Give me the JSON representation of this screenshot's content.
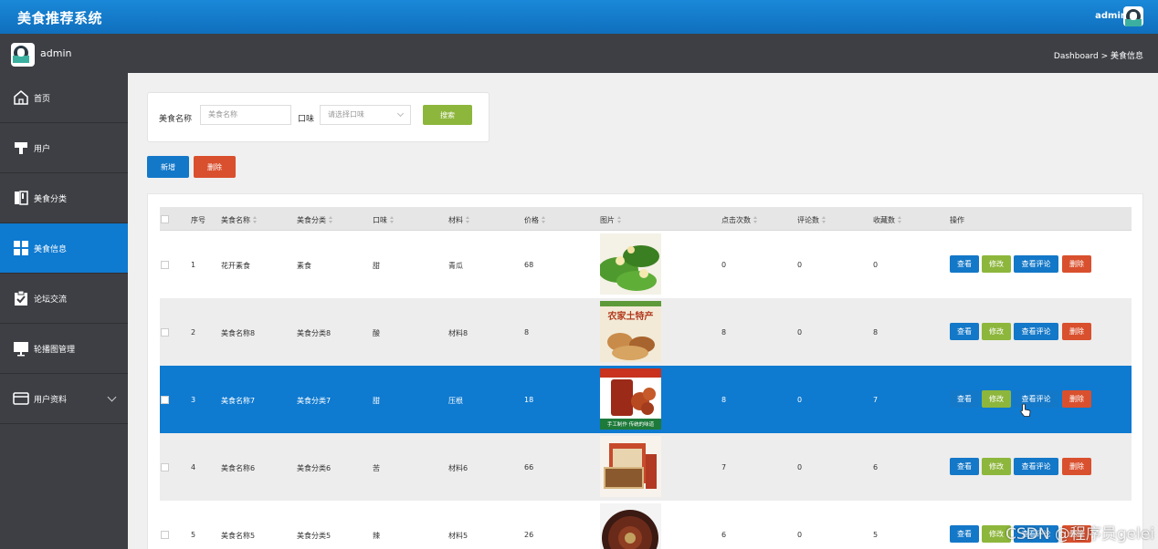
{
  "header": {
    "title": "美食推荐系统",
    "user": "admin"
  },
  "subbar": {
    "user": "admin",
    "breadcrumb": "Dashboard > 美食信息"
  },
  "sidebar": {
    "items": [
      {
        "label": "首页",
        "icon": "home-icon"
      },
      {
        "label": "用户",
        "icon": "user-icon"
      },
      {
        "label": "美食分类",
        "icon": "book-icon"
      },
      {
        "label": "美食信息",
        "icon": "grid-icon",
        "active": true
      },
      {
        "label": "论坛交流",
        "icon": "clipboard-check-icon"
      },
      {
        "label": "轮播图管理",
        "icon": "monitor-icon"
      },
      {
        "label": "用户资料",
        "icon": "card-icon"
      }
    ]
  },
  "search": {
    "name_label": "美食名称",
    "name_placeholder": "美食名称",
    "taste_label": "口味",
    "taste_placeholder": "请选择口味",
    "search_button": "搜索"
  },
  "actions": {
    "add": "新增",
    "delete": "删除"
  },
  "table": {
    "columns": [
      "序号",
      "美食名称",
      "美食分类",
      "口味",
      "材料",
      "价格",
      "图片",
      "点击次数",
      "评论数",
      "收藏数",
      "操作"
    ],
    "row_buttons": {
      "view": "查看",
      "edit": "修改",
      "comments": "查看评论",
      "delete": "删除"
    },
    "rows": [
      {
        "index": "1",
        "name": "花开素食",
        "category": "素食",
        "taste": "甜",
        "material": "青瓜",
        "price": "68",
        "clicks": "0",
        "comments": "0",
        "favorites": "0"
      },
      {
        "index": "2",
        "name": "美食名称8",
        "category": "美食分类8",
        "taste": "酸",
        "material": "材料8",
        "price": "8",
        "clicks": "8",
        "comments": "0",
        "favorites": "8"
      },
      {
        "index": "3",
        "name": "美食名称7",
        "category": "美食分类7",
        "taste": "甜",
        "material": "压根",
        "price": "18",
        "clicks": "8",
        "comments": "0",
        "favorites": "7",
        "selected": true
      },
      {
        "index": "4",
        "name": "美食名称6",
        "category": "美食分类6",
        "taste": "苦",
        "material": "材料6",
        "price": "66",
        "clicks": "7",
        "comments": "0",
        "favorites": "6"
      },
      {
        "index": "5",
        "name": "美食名称5",
        "category": "美食分类5",
        "taste": "辣",
        "material": "材料5",
        "price": "26",
        "clicks": "6",
        "comments": "0",
        "favorites": "5"
      }
    ],
    "images": [
      {
        "label": ""
      },
      {
        "label": "农家土特产"
      },
      {
        "label": "手工制作 传统的味道"
      },
      {
        "label": ""
      },
      {
        "label": ""
      }
    ]
  },
  "watermark": "CSDN @程序员gelei",
  "colors": {
    "primary": "#0e7ad0",
    "green": "#8db63c",
    "red": "#d9502e",
    "dark": "#3d3f44"
  }
}
